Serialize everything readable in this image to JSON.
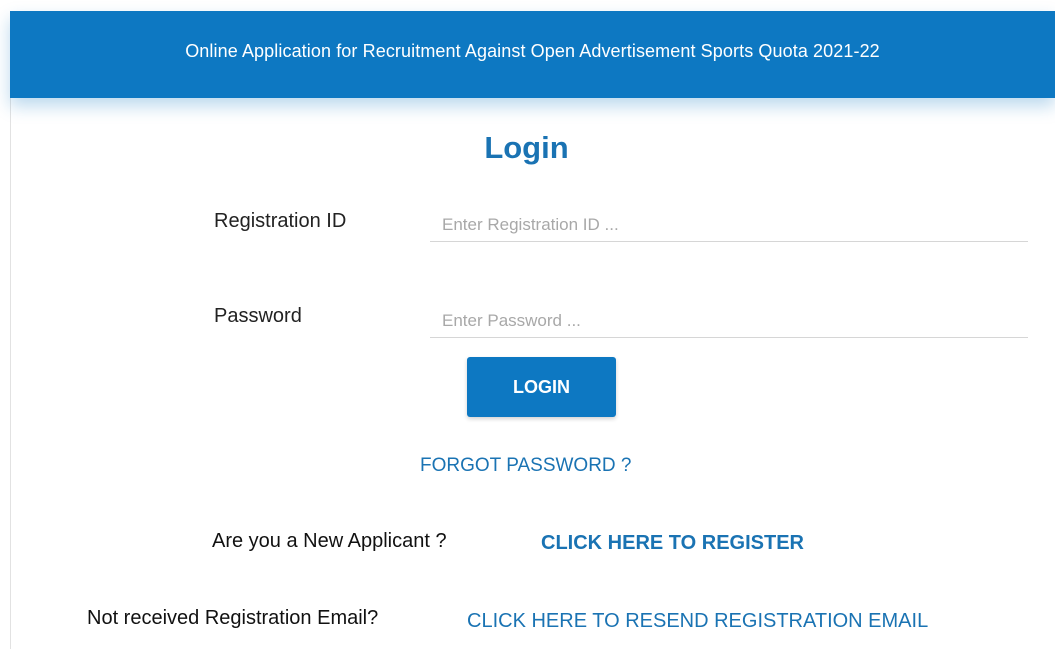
{
  "header": {
    "title": "Online Application for Recruitment Against Open Advertisement Sports Quota 2021-22"
  },
  "login_form": {
    "heading": "Login",
    "registration_id": {
      "label": "Registration ID",
      "placeholder": "Enter Registration ID ...",
      "value": ""
    },
    "password": {
      "label": "Password",
      "placeholder": "Enter Password ...",
      "value": ""
    },
    "login_button_label": "LOGIN",
    "forgot_password_label": "FORGOT PASSWORD ?"
  },
  "register": {
    "prompt": "Are you a New Applicant ?",
    "link_label": "CLICK HERE TO REGISTER"
  },
  "resend": {
    "prompt": "Not received Registration Email?",
    "link_label": "CLICK HERE TO RESEND REGISTRATION EMAIL"
  },
  "colors": {
    "header_background": "#0d78c2",
    "accent_text": "#1a73b3",
    "button_background": "#0d78c2"
  }
}
